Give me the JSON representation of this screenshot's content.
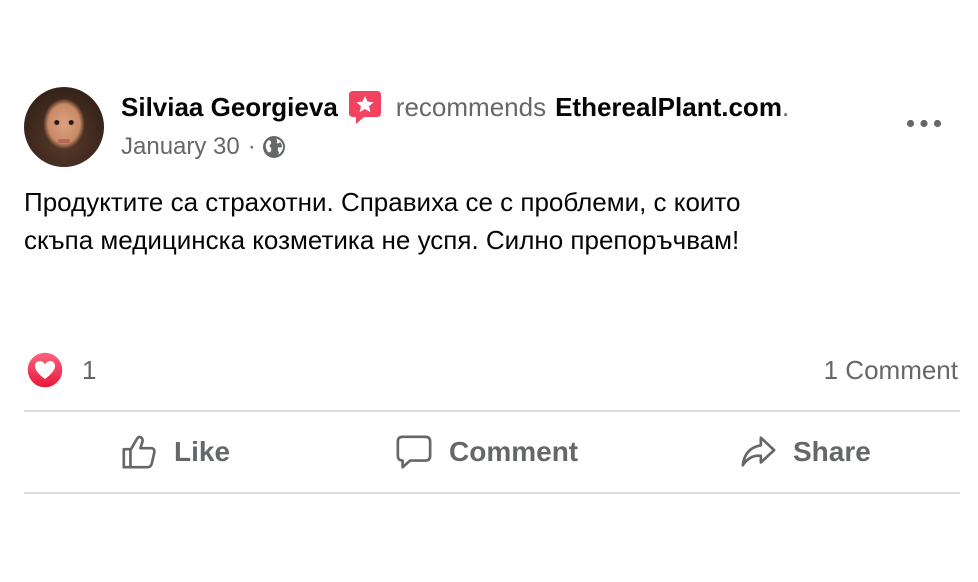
{
  "post": {
    "author": "Silviaa Georgieva",
    "verb": "recommends",
    "page": "EtherealPlant.com",
    "period": ".",
    "date": "January 30",
    "separator": "·",
    "audience_icon": "globe-icon",
    "badge_icon": "recommendation-star-icon",
    "text_lines": [
      "Продуктите са страхотни. Справиха се с проблеми, с които",
      "скъпа медицинска козметика не успя. Силно препоръчвам!"
    ]
  },
  "reactions": {
    "icon": "love-reaction-icon",
    "count": "1",
    "comments": "1 Comment"
  },
  "actions": {
    "like": "Like",
    "comment": "Comment",
    "share": "Share"
  },
  "colors": {
    "secondary_text": "#65676b",
    "primary_text": "#050505",
    "love": "#f33e58",
    "badge": "#f3425f",
    "divider": "#dadde1"
  }
}
